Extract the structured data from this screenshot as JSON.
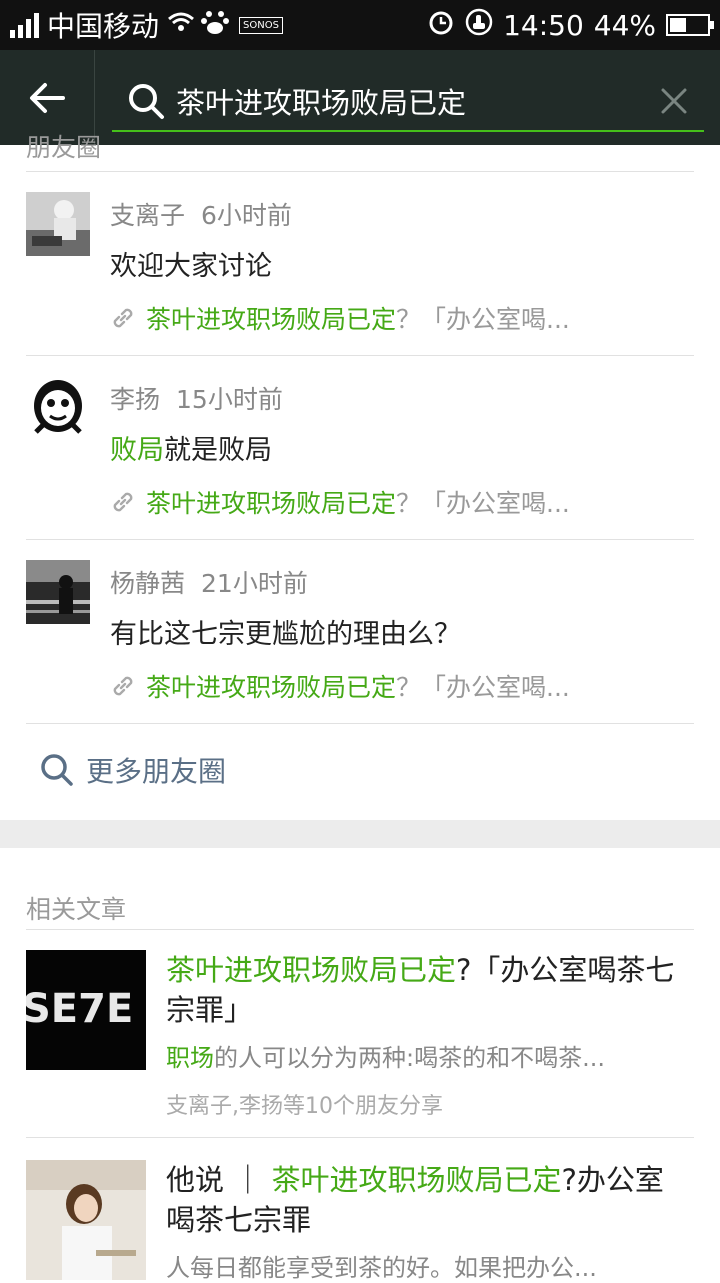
{
  "status_bar": {
    "carrier": "中国移动",
    "time": "14:50",
    "battery": "44%",
    "battery_level": 0.44,
    "icons": [
      "signal-icon",
      "wifi-icon",
      "baidu-icon",
      "sonos-icon",
      "alarm-icon",
      "notification-icon",
      "battery-icon"
    ],
    "sonos": "SONOS"
  },
  "toolbar": {
    "search_query": "茶叶进攻职场败局已定",
    "accent": "#45c01a",
    "background": "#212b28"
  },
  "moments": {
    "section_title": "朋友圈",
    "posts": [
      {
        "author": "支离子",
        "time": "6小时前",
        "text_highlight": "",
        "text": "欢迎大家讨论",
        "link_highlight": "茶叶进攻职场败局已定",
        "link_rest": "？「办公室喝..."
      },
      {
        "author": "李扬",
        "time": "15小时前",
        "text_highlight": "败局",
        "text": "就是败局",
        "link_highlight": "茶叶进攻职场败局已定",
        "link_rest": "？「办公室喝..."
      },
      {
        "author": "杨静茜",
        "time": "21小时前",
        "text_highlight": "",
        "text": "有比这七宗更尴尬的理由么？",
        "link_highlight": "茶叶进攻职场败局已定",
        "link_rest": "？「办公室喝..."
      }
    ],
    "more_label": "更多朋友圈"
  },
  "articles": {
    "section_title": "相关文章",
    "items": [
      {
        "title_highlight": "茶叶进攻职场败局已定",
        "title_rest": "?「办公室喝茶七宗罪」",
        "summary_highlight": "职场",
        "summary_rest": "的人可以分为两种:喝茶的和不喝茶...",
        "source": "支离子,李扬等10个朋友分享",
        "thumb_text": "SE7E"
      },
      {
        "title_prefix": "他说 ｜ ",
        "title_highlight": "茶叶进攻职场败局已定",
        "title_rest": "?办公室喝茶七宗罪",
        "summary_highlight": "",
        "summary_rest": "人每日都能享受到茶的好。如果把办公..."
      }
    ]
  }
}
